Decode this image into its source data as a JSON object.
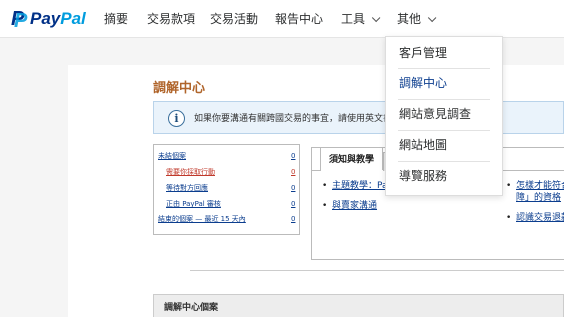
{
  "brand": {
    "pay": "Pay",
    "pal": "Pal"
  },
  "nav": {
    "items": [
      "摘要",
      "交易款項",
      "交易活動",
      "報告中心",
      "工具",
      "其他"
    ]
  },
  "dropdown": {
    "items": [
      "客戶管理",
      "調解中心",
      "網站意見調查",
      "網站地圖",
      "導覽服務"
    ],
    "active_index": 1
  },
  "page": {
    "title": "調解中心",
    "notice": "如果你要溝通有關跨國交易的事宜，請使用英文書"
  },
  "cases": {
    "rows": [
      {
        "label": "未結個案",
        "count": "0"
      },
      {
        "label": "需要你採取行動",
        "count": "0"
      },
      {
        "label": "等待對方回應",
        "count": "0"
      },
      {
        "label": "正由 PayPal 審核",
        "count": "0"
      },
      {
        "label": "結束的個案 — 最近 15 天內",
        "count": "0"
      }
    ]
  },
  "tabs": {
    "active": "須知與教學",
    "links_left": [
      "主題教學：Pa",
      "與賣家溝通"
    ],
    "links_right": [
      "怎樣才能符合",
      "障」的資格",
      "認識交易退款"
    ]
  },
  "section": {
    "title": "調解中心個案"
  },
  "colors": {
    "accent": "#b0652b",
    "link": "#0b3d8e",
    "alert": "#c0392b",
    "brand_dark": "#003087",
    "brand_light": "#009cde"
  }
}
